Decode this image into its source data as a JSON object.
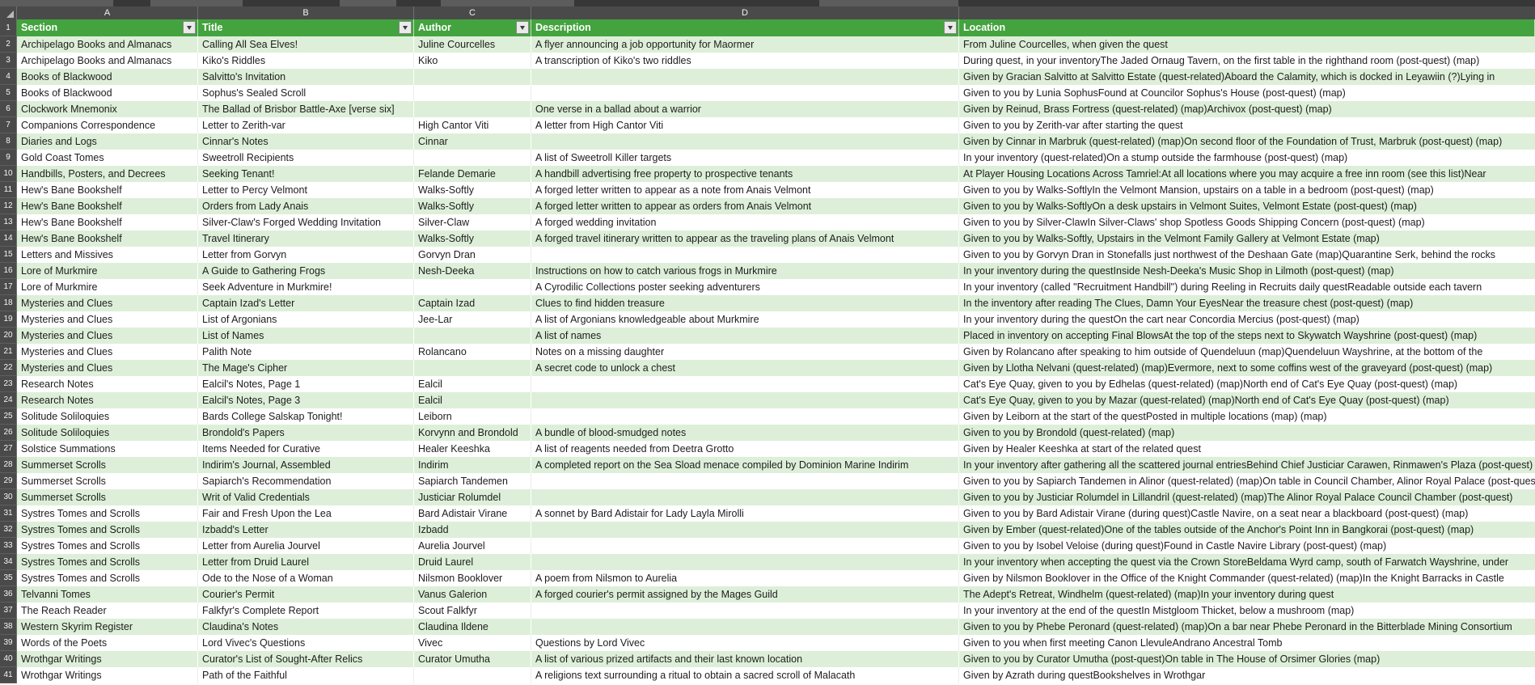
{
  "colors": {
    "header_green": "#43a33e",
    "band_green": "#ddefd8",
    "frame_dark": "#4a4a4a",
    "frame_darker": "#373737",
    "frame_seg": "#5c5c5c",
    "filter_btn_bg": "#eaeaea",
    "filter_btn_border": "#878787",
    "text_dark": "#1d1d1d"
  },
  "columns": {
    "letters": [
      "A",
      "B",
      "C",
      "D",
      ""
    ],
    "headers": [
      "Section",
      "Title",
      "Author",
      "Description",
      "Location"
    ],
    "filters": [
      true,
      true,
      true,
      true,
      false
    ]
  },
  "header_row_number": "1",
  "rows": [
    {
      "n": "2",
      "cells": [
        "Archipelago Books and Almanacs",
        "Calling All Sea Elves!",
        "Juline Courcelles",
        "A flyer announcing a job opportunity for Maormer",
        "From Juline Courcelles, when given the quest"
      ]
    },
    {
      "n": "3",
      "cells": [
        "Archipelago Books and Almanacs",
        "Kiko's Riddles",
        "Kiko",
        "A transcription of Kiko's two riddles",
        "During quest, in your inventoryThe Jaded Ornaug Tavern, on the first table in the righthand room (post-quest) (map)"
      ]
    },
    {
      "n": "4",
      "cells": [
        "Books of Blackwood",
        "Salvitto's Invitation",
        "",
        "",
        "Given by Gracian Salvitto at Salvitto Estate (quest-related)Aboard the Calamity, which is docked in Leyawiin (?)Lying in"
      ]
    },
    {
      "n": "5",
      "cells": [
        "Books of Blackwood",
        "Sophus's Sealed Scroll",
        "",
        "",
        "Given to you by Lunia SophusFound at Councilor Sophus's House (post-quest) (map)"
      ]
    },
    {
      "n": "6",
      "cells": [
        "Clockwork Mnemonix",
        "The Ballad of Brisbor Battle-Axe [verse six]",
        "",
        "One verse in a ballad about a warrior",
        "Given by Reinud, Brass Fortress (quest-related) (map)Archivox (post-quest) (map)"
      ]
    },
    {
      "n": "7",
      "cells": [
        "Companions Correspondence",
        "Letter to Zerith-var",
        "High Cantor Viti",
        "A letter from High Cantor Viti",
        "Given to you by Zerith-var after starting the quest"
      ]
    },
    {
      "n": "8",
      "cells": [
        "Diaries and Logs",
        "Cinnar's Notes",
        "Cinnar",
        "",
        "Given by Cinnar in Marbruk (quest-related) (map)On second floor of the Foundation of Trust, Marbruk (post-quest) (map)"
      ]
    },
    {
      "n": "9",
      "cells": [
        "Gold Coast Tomes",
        "Sweetroll Recipients",
        "",
        "A list of Sweetroll Killer targets",
        "In your inventory (quest-related)On a stump outside the farmhouse (post-quest) (map)"
      ]
    },
    {
      "n": "10",
      "cells": [
        "Handbills, Posters, and Decrees",
        "Seeking Tenant!",
        "Felande Demarie",
        "A handbill advertising free property to prospective tenants",
        "At Player Housing Locations Across Tamriel:At all locations where you may acquire a free inn room (see this list)Near"
      ]
    },
    {
      "n": "11",
      "cells": [
        "Hew's Bane Bookshelf",
        "Letter to Percy Velmont",
        "Walks-Softly",
        "A forged letter written to appear as a note from Anais Velmont",
        "Given to you by Walks-SoftlyIn the Velmont Mansion, upstairs on a table in a bedroom (post-quest) (map)"
      ]
    },
    {
      "n": "12",
      "cells": [
        "Hew's Bane Bookshelf",
        "Orders from Lady Anais",
        "Walks-Softly",
        "A forged letter written to appear as orders from Anais Velmont",
        "Given to you by Walks-SoftlyOn a desk upstairs in Velmont Suites, Velmont Estate (post-quest) (map)"
      ]
    },
    {
      "n": "13",
      "cells": [
        "Hew's Bane Bookshelf",
        "Silver-Claw's Forged Wedding Invitation",
        "Silver-Claw",
        "A forged wedding invitation",
        "Given to you by Silver-ClawIn Silver-Claws' shop Spotless Goods Shipping Concern (post-quest) (map)"
      ]
    },
    {
      "n": "14",
      "cells": [
        "Hew's Bane Bookshelf",
        "Travel Itinerary",
        "Walks-Softly",
        "A forged travel itinerary written to appear as the traveling plans of Anais Velmont",
        "Given to you by Walks-Softly, Upstairs in the Velmont Family Gallery at Velmont Estate (map)"
      ]
    },
    {
      "n": "15",
      "cells": [
        "Letters and Missives",
        "Letter from Gorvyn",
        "Gorvyn Dran",
        "",
        "Given to you by Gorvyn Dran in Stonefalls just northwest of the Deshaan Gate (map)Quarantine Serk, behind the rocks"
      ]
    },
    {
      "n": "16",
      "cells": [
        "Lore of Murkmire",
        "A Guide to Gathering Frogs",
        "Nesh-Deeka",
        "Instructions on how to catch various frogs in Murkmire",
        "In your inventory during the questInside Nesh-Deeka's Music Shop in Lilmoth (post-quest) (map)"
      ]
    },
    {
      "n": "17",
      "cells": [
        "Lore of Murkmire",
        "Seek Adventure in Murkmire!",
        "",
        "A Cyrodilic Collections poster seeking adventurers",
        "In your inventory (called \"Recruitment Handbill\") during Reeling in Recruits daily questReadable outside each tavern"
      ]
    },
    {
      "n": "18",
      "cells": [
        "Mysteries and Clues",
        "Captain Izad's Letter",
        "Captain Izad",
        "Clues to find hidden treasure",
        "In the inventory after reading The Clues, Damn Your EyesNear the treasure chest (post-quest) (map)"
      ]
    },
    {
      "n": "19",
      "cells": [
        "Mysteries and Clues",
        "List of Argonians",
        "Jee-Lar",
        "A list of Argonians knowledgeable about Murkmire",
        "In your inventory during the questOn the cart near Concordia Mercius (post-quest) (map)"
      ]
    },
    {
      "n": "20",
      "cells": [
        "Mysteries and Clues",
        "List of Names",
        "",
        "A list of names",
        "Placed in inventory on accepting Final BlowsAt the top of the steps next to Skywatch Wayshrine (post-quest) (map)"
      ]
    },
    {
      "n": "21",
      "cells": [
        "Mysteries and Clues",
        "Palith Note",
        "Rolancano",
        "Notes on a missing daughter",
        "Given by Rolancano after speaking to him outside of Quendeluun (map)Quendeluun Wayshrine, at the bottom of the"
      ]
    },
    {
      "n": "22",
      "cells": [
        "Mysteries and Clues",
        "The Mage's Cipher",
        "",
        "A secret code to unlock a chest",
        "Given by Llotha Nelvani (quest-related) (map)Evermore, next to some coffins west of the graveyard (post-quest) (map)"
      ]
    },
    {
      "n": "23",
      "cells": [
        "Research Notes",
        "Ealcil's Notes, Page 1",
        "Ealcil",
        "",
        "Cat's Eye Quay, given to you by Edhelas (quest-related) (map)North end of Cat's Eye Quay (post-quest) (map)"
      ]
    },
    {
      "n": "24",
      "cells": [
        "Research Notes",
        "Ealcil's Notes, Page 3",
        "Ealcil",
        "",
        "Cat's Eye Quay, given to you by Mazar (quest-related) (map)North end of Cat's Eye Quay (post-quest) (map)"
      ]
    },
    {
      "n": "25",
      "cells": [
        "Solitude Soliloquies",
        "Bards College Salskap Tonight!",
        "Leiborn",
        "",
        "Given by Leiborn at the start of the questPosted in multiple locations (map) (map)"
      ]
    },
    {
      "n": "26",
      "cells": [
        "Solitude Soliloquies",
        "Brondold's Papers",
        "Korvynn and Brondold",
        "A bundle of blood-smudged notes",
        "Given to you by Brondold (quest-related) (map)"
      ]
    },
    {
      "n": "27",
      "cells": [
        "Solstice Summations",
        "Items Needed for Curative",
        "Healer Keeshka",
        "A list of reagents needed from Deetra Grotto",
        "Given by Healer Keeshka at start of the related quest"
      ]
    },
    {
      "n": "28",
      "cells": [
        "Summerset Scrolls",
        "Indirim's Journal, Assembled",
        "Indirim",
        "A completed report on the Sea Sload menace compiled by Dominion Marine Indirim",
        "In your inventory after gathering all the scattered journal entriesBehind Chief Justiciar Carawen, Rinmawen's Plaza (post-quest)"
      ]
    },
    {
      "n": "29",
      "cells": [
        "Summerset Scrolls",
        "Sapiarch's Recommendation",
        "Sapiarch Tandemen",
        "",
        "Given to you by Sapiarch Tandemen in Alinor (quest-related) (map)On table in Council Chamber, Alinor Royal Palace (post-quest)"
      ]
    },
    {
      "n": "30",
      "cells": [
        "Summerset Scrolls",
        "Writ of Valid Credentials",
        "Justiciar Rolumdel",
        "",
        "Given to you by Justiciar Rolumdel in Lillandril (quest-related) (map)The Alinor Royal Palace Council Chamber (post-quest)"
      ]
    },
    {
      "n": "31",
      "cells": [
        "Systres Tomes and Scrolls",
        "Fair and Fresh Upon the Lea",
        "Bard Adistair Virane",
        "A sonnet by Bard Adistair for Lady Layla Mirolli",
        "Given to you by Bard Adistair Virane  (during quest)Castle Navire, on a seat near a blackboard (post-quest) (map)"
      ]
    },
    {
      "n": "32",
      "cells": [
        "Systres Tomes and Scrolls",
        "Izbadd's Letter",
        "Izbadd",
        "",
        "Given by Ember (quest-related)One of the tables outside of the Anchor's Point Inn in Bangkorai (post-quest) (map)"
      ]
    },
    {
      "n": "33",
      "cells": [
        "Systres Tomes and Scrolls",
        "Letter from Aurelia Jourvel",
        "Aurelia Jourvel",
        "",
        "Given to you by Isobel Veloise (during quest)Found in Castle Navire Library (post-quest) (map)"
      ]
    },
    {
      "n": "34",
      "cells": [
        "Systres Tomes and Scrolls",
        "Letter from Druid Laurel",
        "Druid Laurel",
        "",
        "In your inventory when accepting the quest via the Crown StoreBeldama Wyrd camp, south of Farwatch Wayshrine, under"
      ]
    },
    {
      "n": "35",
      "cells": [
        "Systres Tomes and Scrolls",
        "Ode to the Nose of a Woman",
        "Nilsmon Booklover",
        "A poem from Nilsmon to Aurelia",
        "Given by Nilsmon Booklover in the Office of the Knight Commander (quest-related) (map)In the Knight Barracks in Castle"
      ]
    },
    {
      "n": "36",
      "cells": [
        "Telvanni Tomes",
        "Courier's Permit",
        "Vanus Galerion",
        "A forged courier's permit assigned by the Mages Guild",
        "The Adept's Retreat, Windhelm (quest-related) (map)In your inventory during quest"
      ]
    },
    {
      "n": "37",
      "cells": [
        "The Reach Reader",
        "Falkfyr's Complete Report",
        "Scout Falkfyr",
        "",
        "In your inventory at the end of the questIn Mistgloom Thicket, below a mushroom (map)"
      ]
    },
    {
      "n": "38",
      "cells": [
        "Western Skyrim Register",
        "Claudina's Notes",
        "Claudina Ildene",
        "",
        "Given to you by Phebe Peronard (quest-related) (map)On a bar near Phebe Peronard in the Bitterblade Mining Consortium"
      ]
    },
    {
      "n": "39",
      "cells": [
        "Words of the Poets",
        "Lord Vivec's Questions",
        "Vivec",
        "Questions by Lord Vivec",
        "Given to you when first meeting Canon LlevuleAndrano Ancestral Tomb"
      ]
    },
    {
      "n": "40",
      "cells": [
        "Wrothgar Writings",
        "Curator's List of Sought-After Relics",
        "Curator Umutha",
        "A list of various prized artifacts and their last known location",
        "Given to you by Curator Umutha (post-quest)On table in The House of Orsimer Glories (map)"
      ]
    },
    {
      "n": "41",
      "cells": [
        "Wrothgar Writings",
        "Path of the Faithful",
        "",
        "A religions text surrounding a ritual to obtain a sacred scroll of Malacath",
        "Given by Azrath during questBookshelves in Wrothgar"
      ]
    }
  ]
}
